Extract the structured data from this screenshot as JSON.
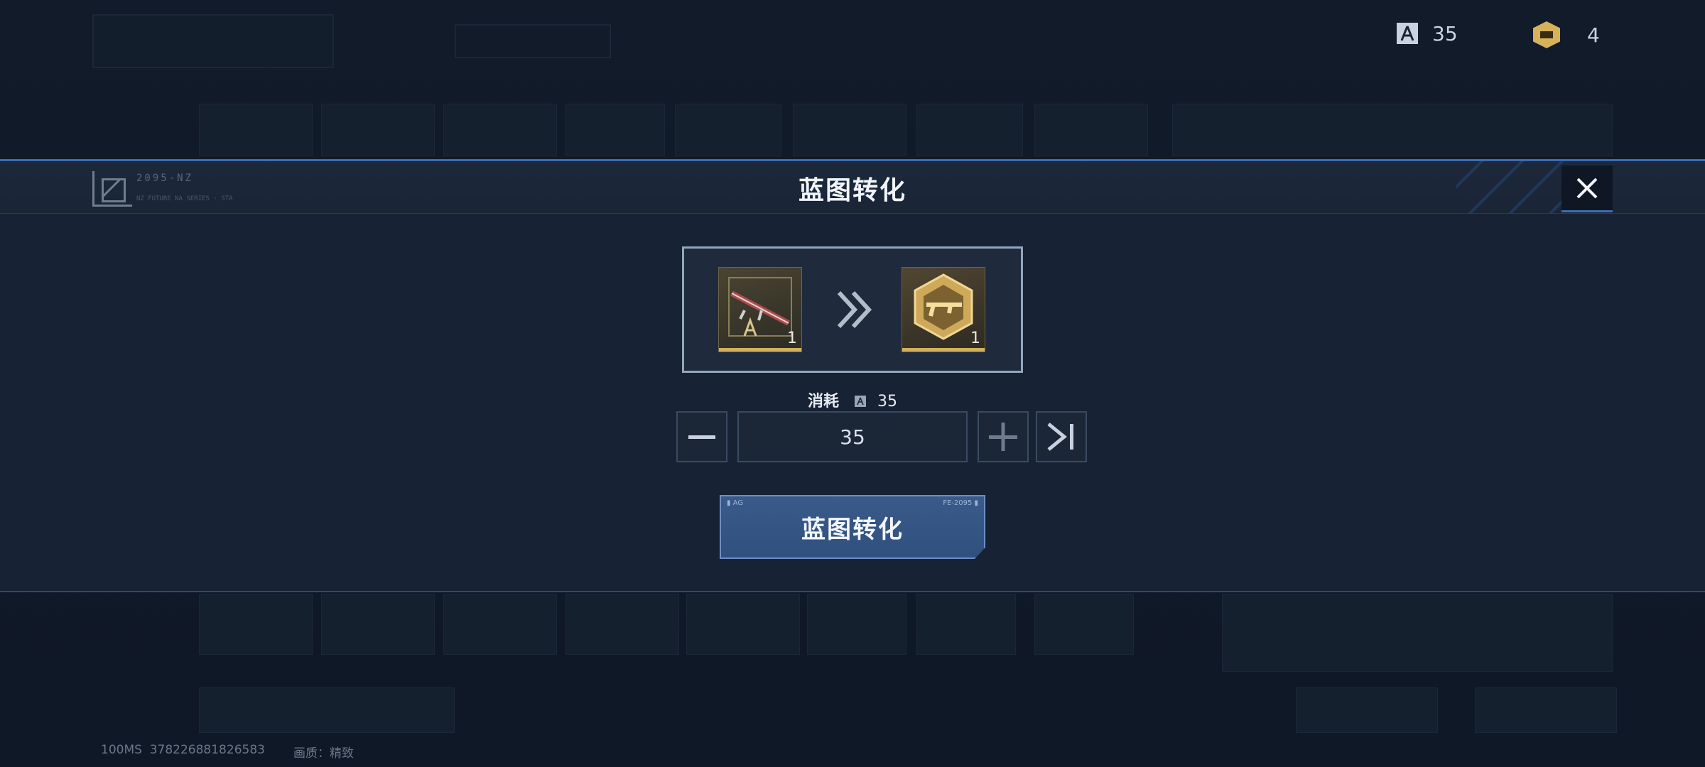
{
  "currency": {
    "blueprint_count": "35",
    "gold_count": "4"
  },
  "modal": {
    "title": "蓝图转化",
    "header_code": "2095-NZ",
    "header_sub": "NZ FUTURE NA SERIES · STA",
    "source_item": {
      "icon": "rifle-blueprint-icon",
      "count": "1"
    },
    "target_item": {
      "icon": "gold-weapon-badge-icon",
      "count": "1"
    },
    "cost_label": "消耗",
    "cost_value": "35",
    "quantity_value": "35",
    "convert_button_label": "蓝图转化",
    "convert_button_tag_left": "▮ AG",
    "convert_button_tag_right": "FE-2095 ▮"
  },
  "footer": {
    "latency": "100MS",
    "uid": "378226881826583",
    "quality": "画质：精致"
  },
  "colors": {
    "accent_blue": "#3b6db4",
    "gold": "#d3b15c",
    "panel": "#172234"
  }
}
